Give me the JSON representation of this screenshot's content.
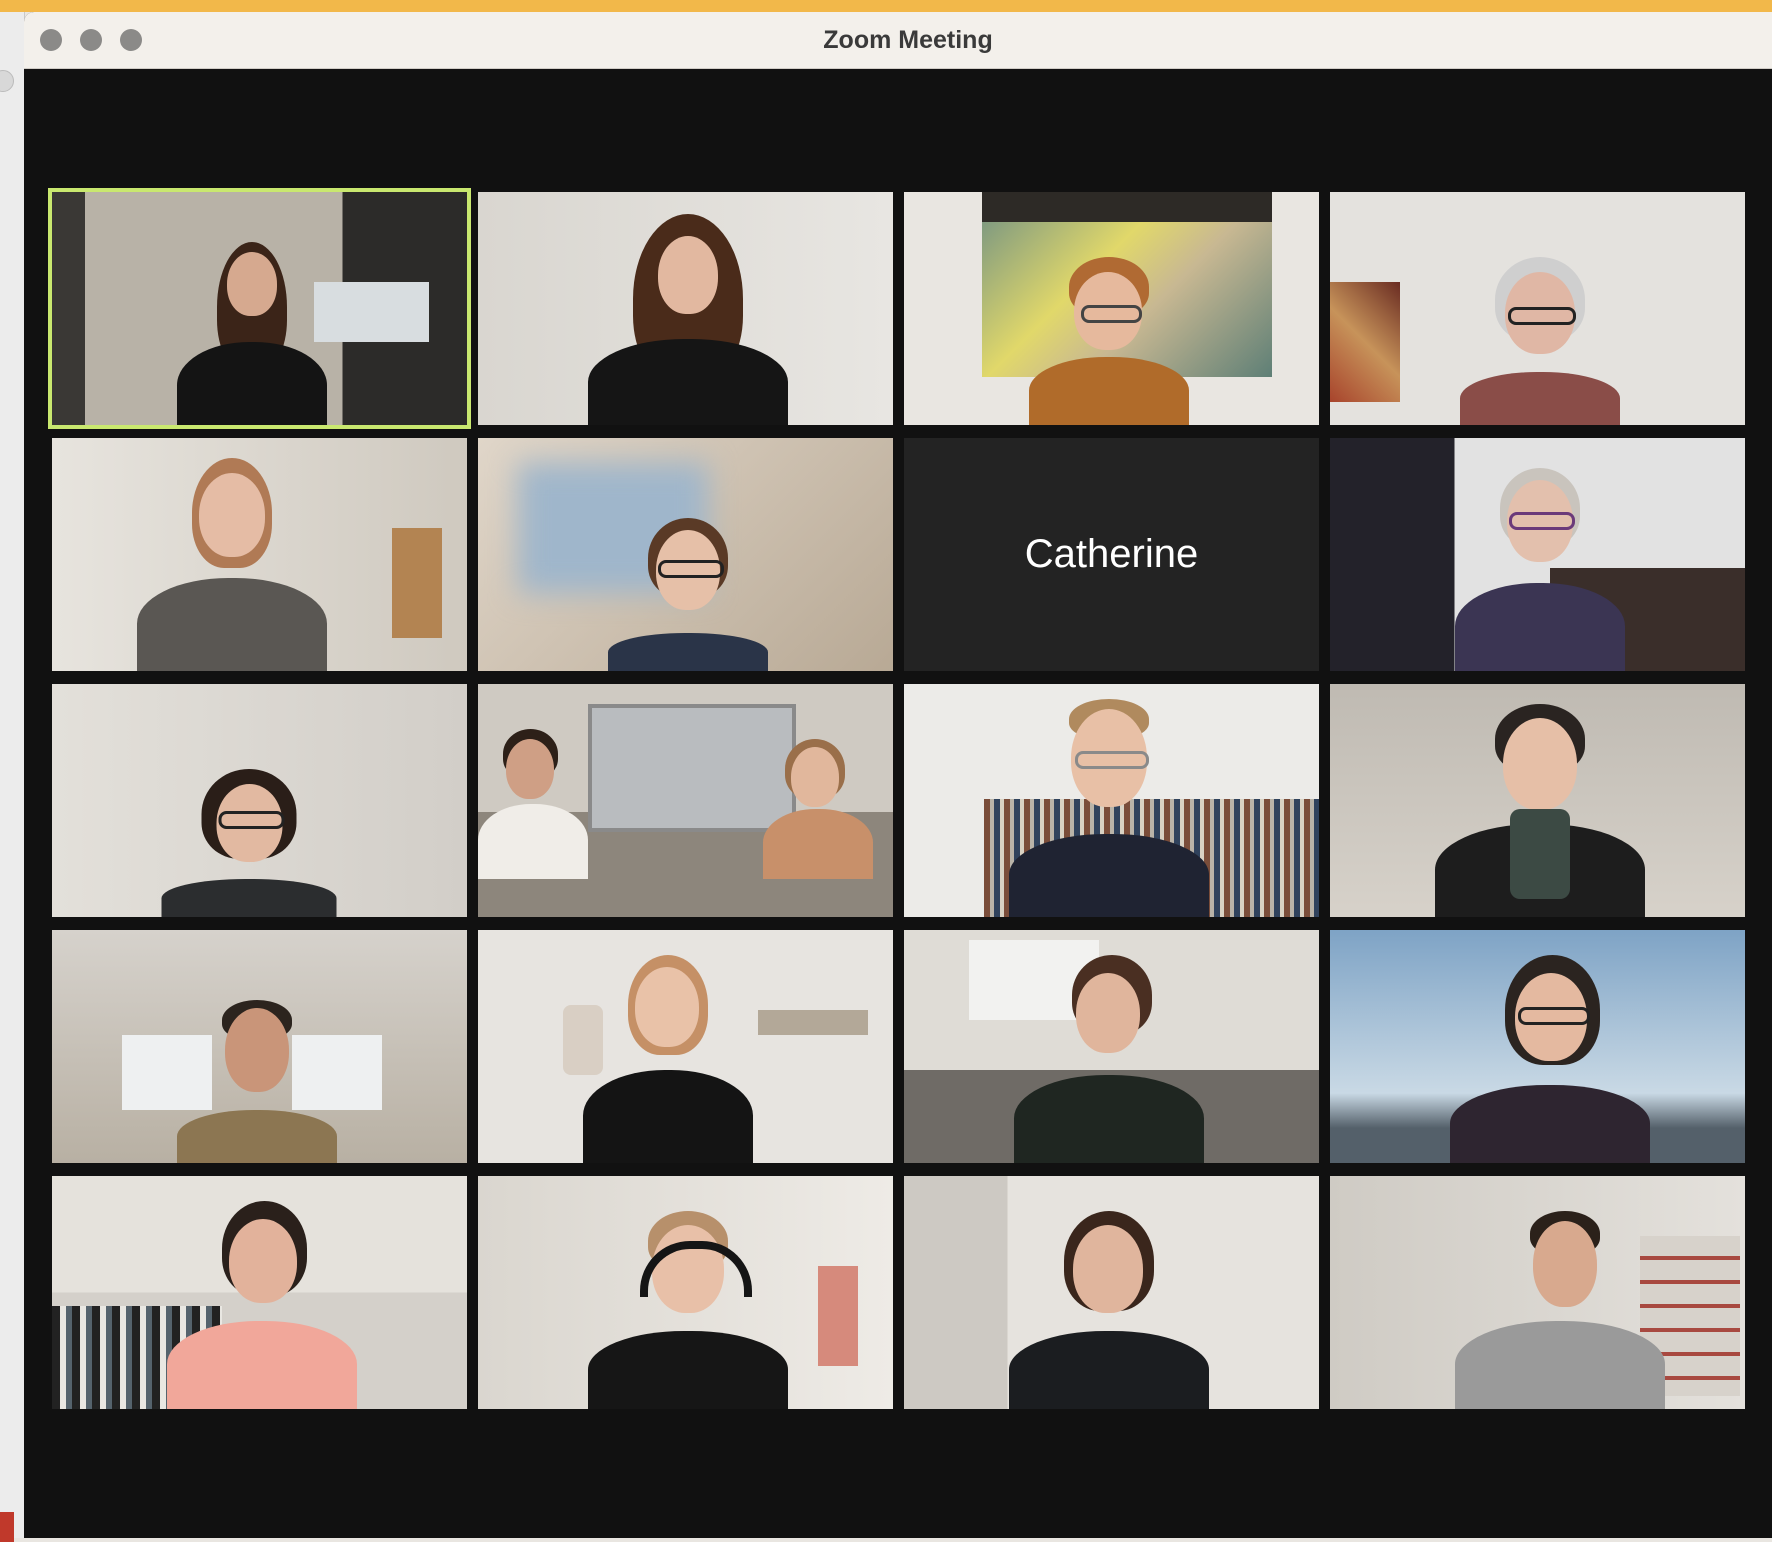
{
  "window": {
    "title": "Zoom Meeting"
  },
  "gallery": {
    "active_speaker_color": "#c9e86f",
    "tiles": [
      {
        "kind": "video",
        "active": true
      },
      {
        "kind": "video"
      },
      {
        "kind": "video"
      },
      {
        "kind": "video"
      },
      {
        "kind": "video"
      },
      {
        "kind": "video"
      },
      {
        "kind": "name",
        "name": "Catherine"
      },
      {
        "kind": "video"
      },
      {
        "kind": "video"
      },
      {
        "kind": "video"
      },
      {
        "kind": "video"
      },
      {
        "kind": "video"
      },
      {
        "kind": "video"
      },
      {
        "kind": "video"
      },
      {
        "kind": "video"
      },
      {
        "kind": "video"
      },
      {
        "kind": "video"
      },
      {
        "kind": "video"
      },
      {
        "kind": "video"
      },
      {
        "kind": "video"
      }
    ]
  }
}
